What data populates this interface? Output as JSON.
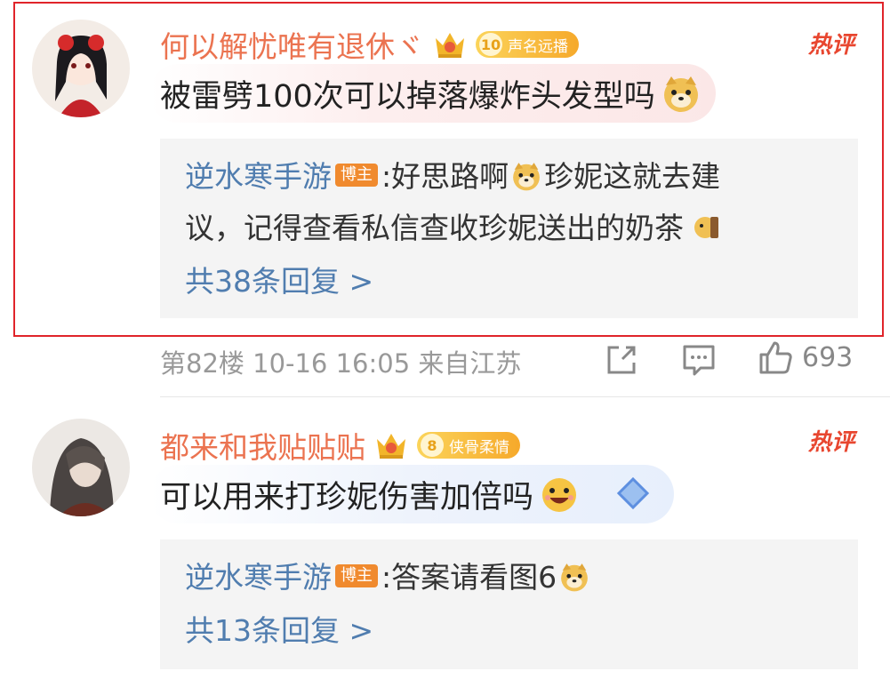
{
  "comments": [
    {
      "username": "何以解忧唯有退休ヾ",
      "badge_level": "10",
      "badge_text": "声名远播",
      "hot_label": "热评",
      "text": "被雷劈100次可以掉落爆炸头发型吗",
      "reply": {
        "author": "逆水寒手游",
        "author_tag": "博主",
        "text_line1": ":好思路啊",
        "text_line1b": "珍妮这就去建",
        "text_line2": "议，记得查看私信查收珍妮送出的奶茶"
      },
      "more_replies": "共38条回复 >",
      "meta": "第82楼  10-16 16:05  来自江苏",
      "like_count": "693"
    },
    {
      "username": "都来和我贴贴贴",
      "badge_level": "8",
      "badge_text": "侠骨柔情",
      "hot_label": "热评",
      "text": "可以用来打珍妮伤害加倍吗",
      "reply": {
        "author": "逆水寒手游",
        "author_tag": "博主",
        "text_line1": ":答案请看图6"
      },
      "more_replies": "共13条回复 >"
    }
  ],
  "icons": {
    "share": "share-icon",
    "comment": "comment-icon",
    "like": "thumbs-up-icon",
    "crown": "crown-icon",
    "doge": "doge-emoji",
    "grin": "grin-emoji"
  },
  "colors": {
    "username": "#eb7350",
    "link": "#507daf",
    "hot": "#e8462f",
    "highlight": "#e0242a"
  }
}
